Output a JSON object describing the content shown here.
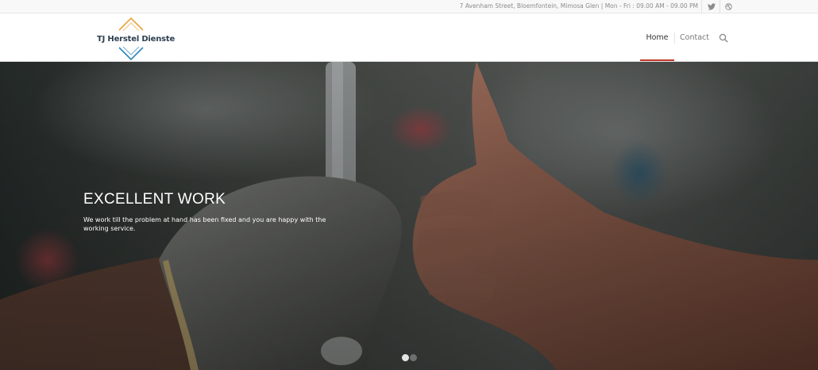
{
  "topbar": {
    "info": "7 Avenham Street, Bloemfontein, Mimosa Glen | Mon - Fri : 09.00 AM - 09.00 PM",
    "icons": [
      "twitter-icon",
      "dribbble-icon"
    ]
  },
  "header": {
    "logo_text": "TJ Herstel Dienste",
    "logo_colors": {
      "top": "#e8a33c",
      "bottom": "#2f86b8"
    },
    "nav": [
      {
        "label": "Home",
        "active": true
      },
      {
        "label": "Contact",
        "active": false
      }
    ],
    "search_icon": "search-icon",
    "accent": "#c0392b"
  },
  "hero": {
    "title": "EXCELLENT WORK",
    "text": "We work till the problem at hand has been fixed and you are happy with the working service.",
    "slides_total": 2,
    "slide_active": 1
  }
}
